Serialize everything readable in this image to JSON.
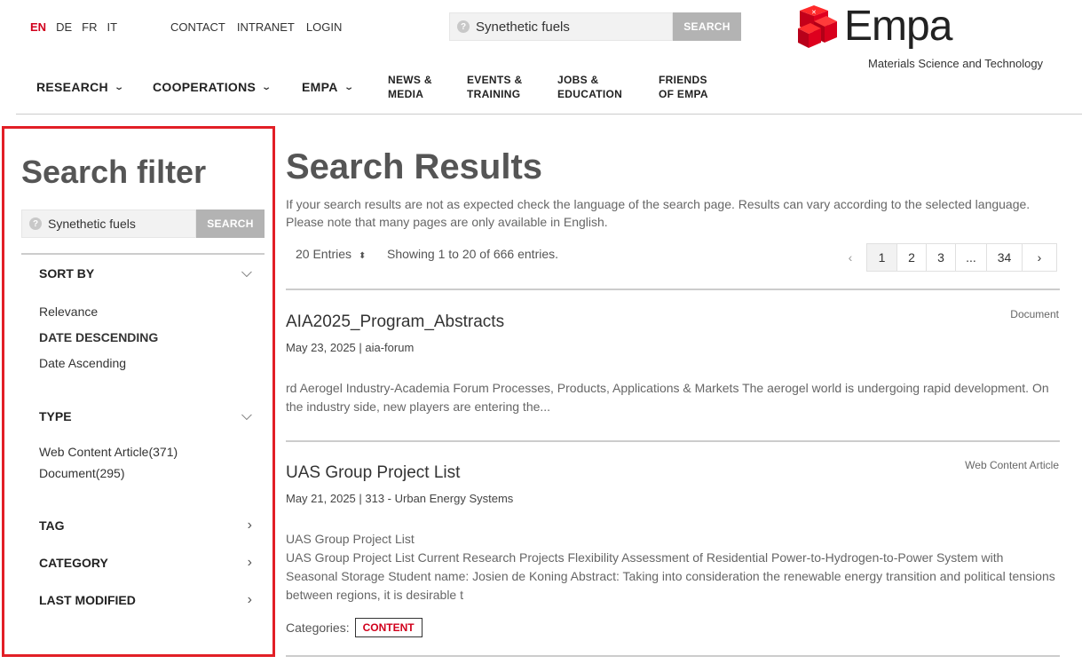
{
  "languages": [
    {
      "code": "EN",
      "active": true
    },
    {
      "code": "DE",
      "active": false
    },
    {
      "code": "FR",
      "active": false
    },
    {
      "code": "IT",
      "active": false
    }
  ],
  "top_links": [
    "CONTACT",
    "INTRANET",
    "LOGIN"
  ],
  "header_search": {
    "value": "Synethetic fuels",
    "button": "SEARCH"
  },
  "logo": {
    "word": "Empa",
    "tagline": "Materials Science and Technology"
  },
  "main_nav": [
    {
      "label": "RESEARCH",
      "dropdown": true
    },
    {
      "label": "COOPERATIONS",
      "dropdown": true
    },
    {
      "label": "EMPA",
      "dropdown": true
    },
    {
      "line1": "NEWS &",
      "line2": "MEDIA"
    },
    {
      "line1": "EVENTS &",
      "line2": "TRAINING"
    },
    {
      "line1": "JOBS &",
      "line2": "EDUCATION"
    },
    {
      "line1": "FRIENDS",
      "line2": "OF EMPA"
    }
  ],
  "sidebar": {
    "title": "Search filter",
    "search": {
      "value": "Synethetic fuels",
      "button": "SEARCH"
    },
    "sort": {
      "label": "SORT BY",
      "options": [
        "Relevance",
        "DATE DESCENDING",
        "Date Ascending"
      ]
    },
    "type": {
      "label": "TYPE",
      "options": [
        "Web Content Article(371)",
        "Document(295)"
      ]
    },
    "tag_label": "TAG",
    "category_label": "CATEGORY",
    "last_modified_label": "LAST MODIFIED"
  },
  "main": {
    "title": "Search Results",
    "note": "If your search results are not as expected check the language of the search page. Results can vary according to the selected language. Please note that many pages are only available in English.",
    "entries_select": "20 Entries",
    "showing": "Showing 1 to 20 of 666 entries.",
    "pagination": [
      "1",
      "2",
      "3",
      "...",
      "34"
    ],
    "current_page": "1",
    "results": [
      {
        "title": "AIA2025_Program_Abstracts",
        "type": "Document",
        "meta": "May 23, 2025 | aia-forum",
        "text": "rd Aerogel Industry-Academia Forum Processes, Products, Applications & Markets The aerogel world is undergoing rapid development. On the industry side, new players are entering the..."
      },
      {
        "title": "UAS Group Project List",
        "type": "Web Content Article",
        "meta": "May 21, 2025 | 313 - Urban Energy Systems",
        "subtitle": "UAS Group Project List",
        "text": "UAS Group Project List Current Research Projects Flexibility Assessment of Residential Power-to-Hydrogen-to-Power System with Seasonal Storage Student name: Josien de Koning Abstract: Taking into consideration the renewable energy transition and political tensions between regions, it is desirable t",
        "categories_label": "Categories:",
        "category": "CONTENT"
      }
    ]
  },
  "colors": {
    "accent": "#d1001c",
    "highlight_border": "#e21f26",
    "button_gray": "#b3b3b3"
  }
}
